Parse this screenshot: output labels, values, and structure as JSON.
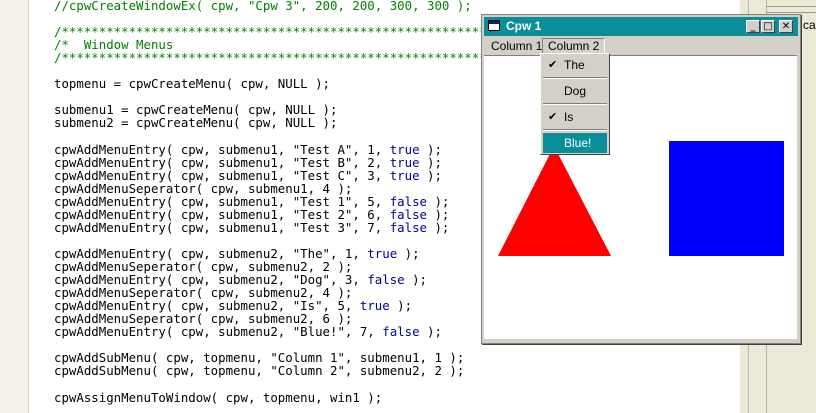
{
  "editor": {
    "lines": [
      {
        "text": "//cpwCreateWindowEx( cpw, \"Cpw 3\", 200, 200, 300, 300 );",
        "kind": "comment"
      },
      {
        "text": "",
        "kind": "code"
      },
      {
        "text": "/***************************************************************",
        "kind": "comment"
      },
      {
        "text": "/*  Window Menus                                             *",
        "kind": "comment"
      },
      {
        "text": "/***************************************************************",
        "kind": "comment"
      },
      {
        "text": "",
        "kind": "code"
      },
      {
        "text": "topmenu = cpwCreateMenu( cpw, NULL );",
        "kind": "code"
      },
      {
        "text": "",
        "kind": "code"
      },
      {
        "text": "submenu1 = cpwCreateMenu( cpw, NULL );",
        "kind": "code"
      },
      {
        "text": "submenu2 = cpwCreateMenu( cpw, NULL );",
        "kind": "code"
      },
      {
        "text": "",
        "kind": "code"
      },
      {
        "text": "cpwAddMenuEntry( cpw, submenu1, \"Test A\", 1, ",
        "bool": "true",
        "tail": " );",
        "kind": "code"
      },
      {
        "text": "cpwAddMenuEntry( cpw, submenu1, \"Test B\", 2, ",
        "bool": "true",
        "tail": " );",
        "kind": "code"
      },
      {
        "text": "cpwAddMenuEntry( cpw, submenu1, \"Test C\", 3, ",
        "bool": "true",
        "tail": " );",
        "kind": "code"
      },
      {
        "text": "cpwAddMenuSeperator( cpw, submenu1, 4 );",
        "kind": "code"
      },
      {
        "text": "cpwAddMenuEntry( cpw, submenu1, \"Test 1\", 5, ",
        "bool": "false",
        "tail": " );",
        "kind": "code"
      },
      {
        "text": "cpwAddMenuEntry( cpw, submenu1, \"Test 2\", 6, ",
        "bool": "false",
        "tail": " );",
        "kind": "code"
      },
      {
        "text": "cpwAddMenuEntry( cpw, submenu1, \"Test 3\", 7, ",
        "bool": "false",
        "tail": " );",
        "kind": "code"
      },
      {
        "text": "",
        "kind": "code"
      },
      {
        "text": "cpwAddMenuEntry( cpw, submenu2, \"The\", 1, ",
        "bool": "true",
        "tail": " );",
        "kind": "code"
      },
      {
        "text": "cpwAddMenuSeperator( cpw, submenu2, 2 );",
        "kind": "code"
      },
      {
        "text": "cpwAddMenuEntry( cpw, submenu2, \"Dog\", 3, ",
        "bool": "false",
        "tail": " );",
        "kind": "code"
      },
      {
        "text": "cpwAddMenuSeperator( cpw, submenu2, 4 );",
        "kind": "code"
      },
      {
        "text": "cpwAddMenuEntry( cpw, submenu2, \"Is\", 5, ",
        "bool": "true",
        "tail": " );",
        "kind": "code"
      },
      {
        "text": "cpwAddMenuSeperator( cpw, submenu2, 6 );",
        "kind": "code"
      },
      {
        "text": "cpwAddMenuEntry( cpw, submenu2, \"Blue!\", 7, ",
        "bool": "false",
        "tail": " );",
        "kind": "code"
      },
      {
        "text": "",
        "kind": "code"
      },
      {
        "text": "cpwAddSubMenu( cpw, topmenu, \"Column 1\", submenu1, 1 );",
        "kind": "code"
      },
      {
        "text": "cpwAddSubMenu( cpw, topmenu, \"Column 2\", submenu2, 2 );",
        "kind": "code"
      },
      {
        "text": "",
        "kind": "code"
      },
      {
        "text": "cpwAssignMenuToWindow( cpw, topmenu, win1 );",
        "kind": "code"
      }
    ]
  },
  "right_panel": {
    "partial_text": "ca"
  },
  "window": {
    "title": "Cpw 1",
    "minimize_glyph": "_",
    "maximize_glyph": "□",
    "close_glyph": "✕",
    "menu": [
      {
        "label": "Column 1",
        "open": false
      },
      {
        "label": "Column 2",
        "open": true
      }
    ],
    "dropdown": [
      {
        "label": "The",
        "checked": true
      },
      {
        "separator": true
      },
      {
        "label": "Dog",
        "checked": false
      },
      {
        "separator": true
      },
      {
        "label": "Is",
        "checked": true
      },
      {
        "separator": true
      },
      {
        "label": "Blue!",
        "checked": false,
        "selected": true
      }
    ],
    "check_glyph": "✔",
    "shapes": {
      "triangle_color": "#ff0000",
      "square_color": "#0000ff"
    }
  },
  "colors": {
    "titlebar": "#0a8e9a",
    "comment": "#008000",
    "keyword_bool": "#00008b"
  }
}
